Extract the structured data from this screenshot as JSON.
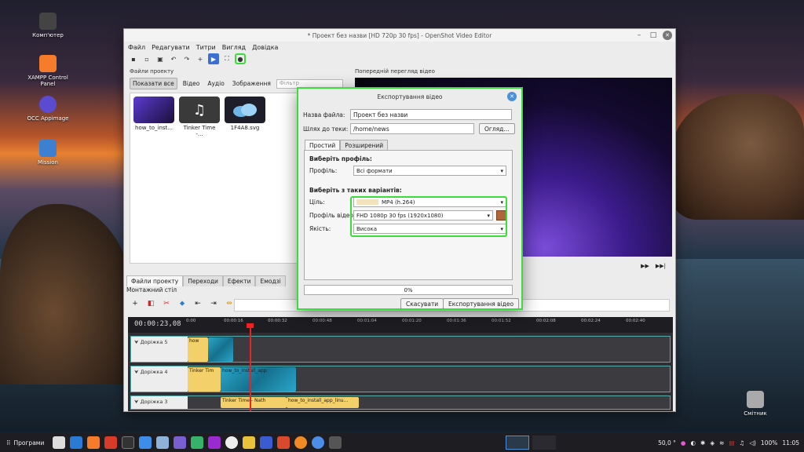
{
  "desktop": {
    "icons": [
      {
        "label": "Комп'ютер",
        "color": "#444"
      },
      {
        "label": "XAMPP Control Panel",
        "color": "#f47c2b"
      },
      {
        "label": "OCC Appimage",
        "color": "#5b4bd1"
      },
      {
        "label": "Mission",
        "color": "#3d7fd1"
      },
      {
        "label": "Смітник",
        "color": "#aaa"
      }
    ]
  },
  "window": {
    "title": "* Проект без назви [HD 720p 30 fps] - OpenShot Video Editor",
    "menu": [
      "Файл",
      "Редагувати",
      "Титри",
      "Вигляд",
      "Довідка"
    ]
  },
  "files": {
    "panel_title": "Файли проекту",
    "filters": [
      "Показати все",
      "Відео",
      "Аудіо",
      "Зображення"
    ],
    "filter_placeholder": "Фільтр",
    "items": [
      {
        "name": "how_to_inst...",
        "color": "#2b1a5c"
      },
      {
        "name": "Tinker Time -...",
        "color": "#3a3a3a"
      },
      {
        "name": "1F4A8.svg",
        "color": "#1e1e2a"
      }
    ]
  },
  "bottom_tabs": [
    "Файли проекту",
    "Переходи",
    "Ефекти",
    "Емодзі"
  ],
  "preview": {
    "panel_title": "Попередній перегляд відео"
  },
  "timeline": {
    "title": "Монтажний стіл",
    "timecode": "00:00:23,08",
    "ticks": [
      "0:00",
      "00:00:16",
      "00:00:32",
      "00:00:48",
      "00:01:04",
      "00:01:20",
      "00:01:36",
      "00:01:52",
      "00:02:08",
      "00:02:24",
      "00:02:40"
    ],
    "tracks": [
      {
        "label": "Доріжка 5",
        "clips": [
          "how"
        ]
      },
      {
        "label": "Доріжка 4",
        "clips": [
          "Tinker Tim",
          "how_to_install_app"
        ]
      },
      {
        "label": "Доріжка 3",
        "clips": [
          "Tinker Time - Nath",
          "how_to_install_app_linu..."
        ]
      }
    ]
  },
  "dialog": {
    "title": "Експортування відео",
    "filename_label": "Назва файла:",
    "filename_value": "Проект без назви",
    "folder_label": "Шлях до теки:",
    "folder_value": "/home/news",
    "browse_label": "Огляд...",
    "tabs": [
      "Простий",
      "Розширений"
    ],
    "profile_section": "Виберіть профіль:",
    "profile_label": "Профіль:",
    "profile_value": "Всі формати",
    "options_section": "Виберіть з таких варіантів:",
    "target_label": "Ціль:",
    "target_value": "MP4 (h.264)",
    "video_profile_label": "Профіль відео:",
    "video_profile_value": "FHD 1080p 30 fps (1920x1080)",
    "quality_label": "Якість:",
    "quality_value": "Висока",
    "progress_text": "0%",
    "progress_value": 0,
    "cancel_label": "Скасувати",
    "export_label": "Експортування відео"
  },
  "taskbar": {
    "start_label": "Програми",
    "zoom": "50,0 °",
    "battery": "100%",
    "time": "11:05"
  }
}
